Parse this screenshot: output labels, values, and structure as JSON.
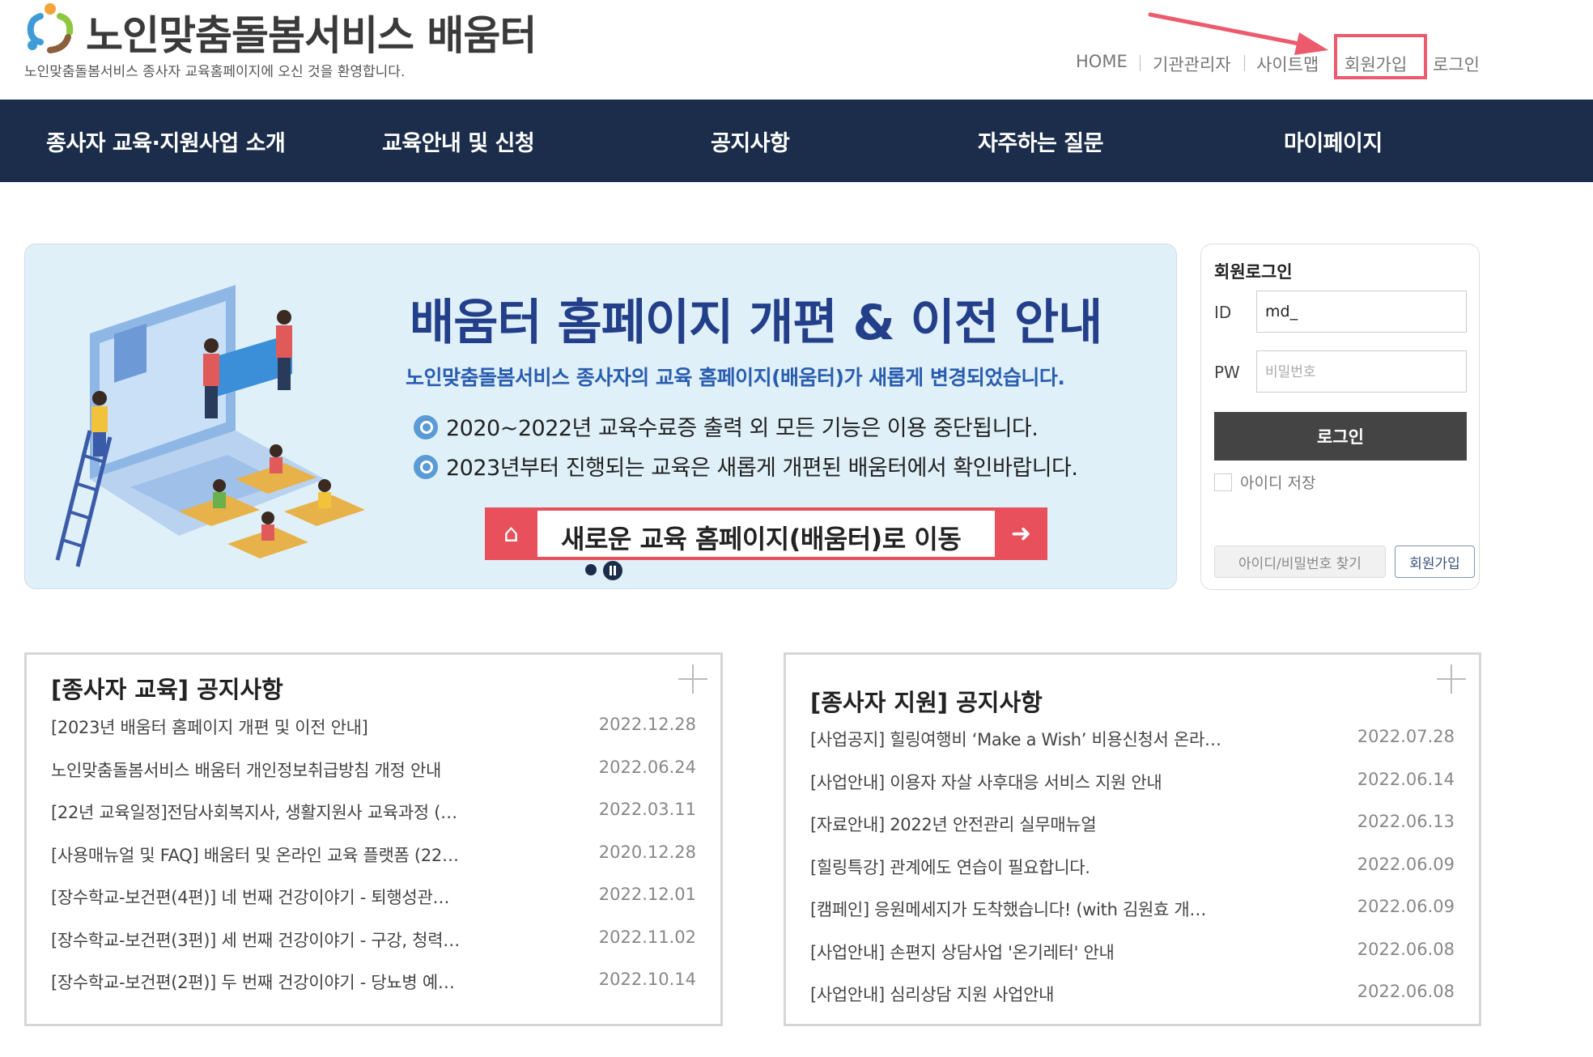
{
  "header": {
    "site_title": "노인맞춤돌봄서비스 배움터",
    "site_subtitle": "노인맞춤돌봄서비스 종사자 교육홈페이지에 오신 것을 환영합니다.",
    "util_links": [
      "HOME",
      "기관관리자",
      "사이트맵",
      "회원가입",
      "로그인"
    ]
  },
  "nav": {
    "items": [
      "종사자 교육·지원사업 소개",
      "교육안내 및 신청",
      "공지사항",
      "자주하는 질문",
      "마이페이지"
    ]
  },
  "banner": {
    "title": "배움터 홈페이지 개편 & 이전 안내",
    "subtitle": "노인맞춤돌봄서비스 종사자의 교육 홈페이지(배움터)가 새롭게 변경되었습니다.",
    "line1": "2020~2022년 교육수료증 출력 외 모든 기능은 이용 중단됩니다.",
    "line2": "2023년부터 진행되는 교육은 새롭게 개편된 배움터에서 확인바랍니다.",
    "button": "새로운 교육 홈페이지(배움터)로 이동"
  },
  "login": {
    "title": "회원로그인",
    "id_label": "ID",
    "id_value": "md_",
    "pw_label": "PW",
    "pw_placeholder": "비밀번호",
    "login_button": "로그인",
    "remember_label": "아이디 저장",
    "find_button": "아이디/비밀번호 찾기",
    "join_button": "회원가입"
  },
  "notice_edu": {
    "title": "[종사자 교육] 공지사항",
    "items": [
      {
        "text": "[2023년 배움터 홈페이지 개편 및 이전 안내]",
        "date": "2022.12.28"
      },
      {
        "text": "노인맞춤돌봄서비스 배움터 개인정보취급방침 개정 안내",
        "date": "2022.06.24"
      },
      {
        "text": "[22년 교육일정]전담사회복지사, 생활지원사 교육과정 (…",
        "date": "2022.03.11"
      },
      {
        "text": "[사용매뉴얼 및 FAQ] 배움터 및 온라인 교육 플랫폼 (22…",
        "date": "2020.12.28"
      },
      {
        "text": "[장수학교-보건편(4편)] 네 번째 건강이야기 - 퇴행성관…",
        "date": "2022.12.01"
      },
      {
        "text": "[장수학교-보건편(3편)] 세 번째 건강이야기 - 구강, 청력…",
        "date": "2022.11.02"
      },
      {
        "text": "[장수학교-보건편(2편)] 두 번째 건강이야기 - 당뇨병 예…",
        "date": "2022.10.14"
      }
    ]
  },
  "notice_support": {
    "title": "[종사자 지원] 공지사항",
    "items": [
      {
        "text": "[사업공지] 힐링여행비 ‘Make a Wish’ 비용신청서 온라…",
        "date": "2022.07.28"
      },
      {
        "text": "[사업안내] 이용자 자살 사후대응 서비스 지원 안내",
        "date": "2022.06.14"
      },
      {
        "text": "[자료안내] 2022년 안전관리 실무매뉴얼",
        "date": "2022.06.13"
      },
      {
        "text": "[힐링특강] 관계에도 연습이 필요합니다.",
        "date": "2022.06.09"
      },
      {
        "text": "[캠페인] 응원메세지가 도착했습니다! (with 김원효 개…",
        "date": "2022.06.09"
      },
      {
        "text": "[사업안내] 손편지 상담사업 '온기레터' 안내",
        "date": "2022.06.08"
      },
      {
        "text": "[사업안내] 심리상담 지원 사업안내",
        "date": "2022.06.08"
      }
    ]
  },
  "colors": {
    "nav_bg": "#1b2d4a",
    "banner_title": "#243f8a",
    "highlight": "#ec5a6d",
    "login_button": "#444444"
  }
}
